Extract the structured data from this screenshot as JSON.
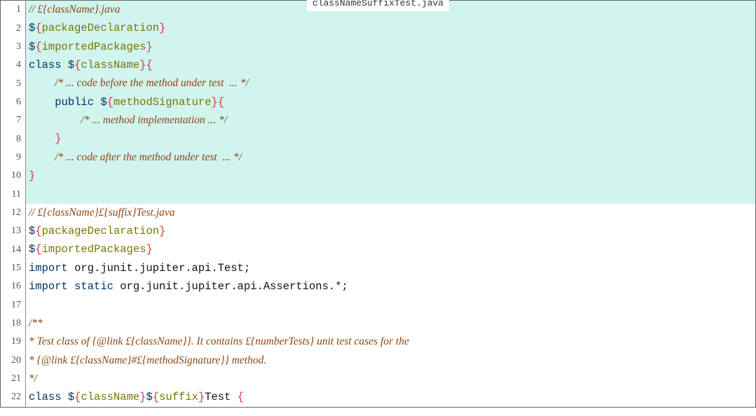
{
  "title": "classNameSuffixTest.java",
  "highlight_range": [
    1,
    11
  ],
  "lines": [
    {
      "n": 1,
      "indent": 0,
      "tokens": [
        {
          "t": "comment",
          "v": "// £{className}.java"
        }
      ]
    },
    {
      "n": 2,
      "indent": 0,
      "tokens": [
        {
          "t": "dollar",
          "v": "$"
        },
        {
          "t": "brace-open",
          "v": "{"
        },
        {
          "t": "var-name",
          "v": "packageDeclaration"
        },
        {
          "t": "brace-close",
          "v": "}"
        }
      ]
    },
    {
      "n": 3,
      "indent": 0,
      "tokens": [
        {
          "t": "dollar",
          "v": "$"
        },
        {
          "t": "brace-open",
          "v": "{"
        },
        {
          "t": "var-name",
          "v": "importedPackages"
        },
        {
          "t": "brace-close",
          "v": "}"
        }
      ]
    },
    {
      "n": 4,
      "indent": 0,
      "tokens": [
        {
          "t": "kw",
          "v": "class"
        },
        {
          "t": "plain",
          "v": " "
        },
        {
          "t": "dollar",
          "v": "$"
        },
        {
          "t": "brace-open",
          "v": "{"
        },
        {
          "t": "var-name",
          "v": "className"
        },
        {
          "t": "brace-close",
          "v": "}"
        },
        {
          "t": "brace-open",
          "v": "{"
        }
      ]
    },
    {
      "n": 5,
      "indent": 4,
      "tokens": [
        {
          "t": "comment",
          "v": "/* ... code before the method under test  ... */"
        }
      ]
    },
    {
      "n": 6,
      "indent": 4,
      "tokens": [
        {
          "t": "kw",
          "v": "public"
        },
        {
          "t": "plain",
          "v": " "
        },
        {
          "t": "dollar",
          "v": "$"
        },
        {
          "t": "brace-open",
          "v": "{"
        },
        {
          "t": "var-name",
          "v": "methodSignature"
        },
        {
          "t": "brace-close",
          "v": "}"
        },
        {
          "t": "brace-open",
          "v": "{"
        }
      ]
    },
    {
      "n": 7,
      "indent": 8,
      "tokens": [
        {
          "t": "comment",
          "v": "/* ... method implementation ... */"
        }
      ]
    },
    {
      "n": 8,
      "indent": 4,
      "tokens": [
        {
          "t": "brace-close",
          "v": "}"
        }
      ]
    },
    {
      "n": 9,
      "indent": 4,
      "tokens": [
        {
          "t": "comment",
          "v": "/* ... code after the method under test  ... */"
        }
      ]
    },
    {
      "n": 10,
      "indent": 0,
      "tokens": [
        {
          "t": "brace-close",
          "v": "}"
        }
      ]
    },
    {
      "n": 11,
      "indent": 0,
      "tokens": []
    },
    {
      "n": 12,
      "indent": 0,
      "tokens": [
        {
          "t": "comment",
          "v": "// £{className}£{suffix}Test.java"
        }
      ]
    },
    {
      "n": 13,
      "indent": 0,
      "tokens": [
        {
          "t": "dollar",
          "v": "$"
        },
        {
          "t": "brace-open",
          "v": "{"
        },
        {
          "t": "var-name",
          "v": "packageDeclaration"
        },
        {
          "t": "brace-close",
          "v": "}"
        }
      ]
    },
    {
      "n": 14,
      "indent": 0,
      "tokens": [
        {
          "t": "dollar",
          "v": "$"
        },
        {
          "t": "brace-open",
          "v": "{"
        },
        {
          "t": "var-name",
          "v": "importedPackages"
        },
        {
          "t": "brace-close",
          "v": "}"
        }
      ]
    },
    {
      "n": 15,
      "indent": 0,
      "tokens": [
        {
          "t": "kw",
          "v": "import"
        },
        {
          "t": "plain",
          "v": " org.junit.jupiter.api.Test;"
        }
      ]
    },
    {
      "n": 16,
      "indent": 0,
      "tokens": [
        {
          "t": "kw",
          "v": "import"
        },
        {
          "t": "plain",
          "v": " "
        },
        {
          "t": "kw",
          "v": "static"
        },
        {
          "t": "plain",
          "v": " org.junit.jupiter.api.Assertions.*;"
        }
      ]
    },
    {
      "n": 17,
      "indent": 0,
      "tokens": []
    },
    {
      "n": 18,
      "indent": 0,
      "tokens": [
        {
          "t": "comment",
          "v": "/**"
        }
      ]
    },
    {
      "n": 19,
      "indent": 0,
      "tokens": [
        {
          "t": "comment",
          "v": "* Test class of {@link £{className}}. It contains £{numberTests} unit test cases for the"
        }
      ]
    },
    {
      "n": 20,
      "indent": 0,
      "tokens": [
        {
          "t": "comment",
          "v": "* {@link £{className}#£{methodSignature}} method."
        }
      ]
    },
    {
      "n": 21,
      "indent": 0,
      "tokens": [
        {
          "t": "comment",
          "v": "*/"
        }
      ]
    },
    {
      "n": 22,
      "indent": 0,
      "tokens": [
        {
          "t": "kw",
          "v": "class"
        },
        {
          "t": "plain",
          "v": " "
        },
        {
          "t": "dollar",
          "v": "$"
        },
        {
          "t": "brace-open",
          "v": "{"
        },
        {
          "t": "var-name",
          "v": "className"
        },
        {
          "t": "brace-close",
          "v": "}"
        },
        {
          "t": "dollar",
          "v": "$"
        },
        {
          "t": "brace-open",
          "v": "{"
        },
        {
          "t": "var-name",
          "v": "suffix"
        },
        {
          "t": "brace-close",
          "v": "}"
        },
        {
          "t": "plain",
          "v": "Test "
        },
        {
          "t": "brace-open",
          "v": "{"
        }
      ]
    }
  ]
}
